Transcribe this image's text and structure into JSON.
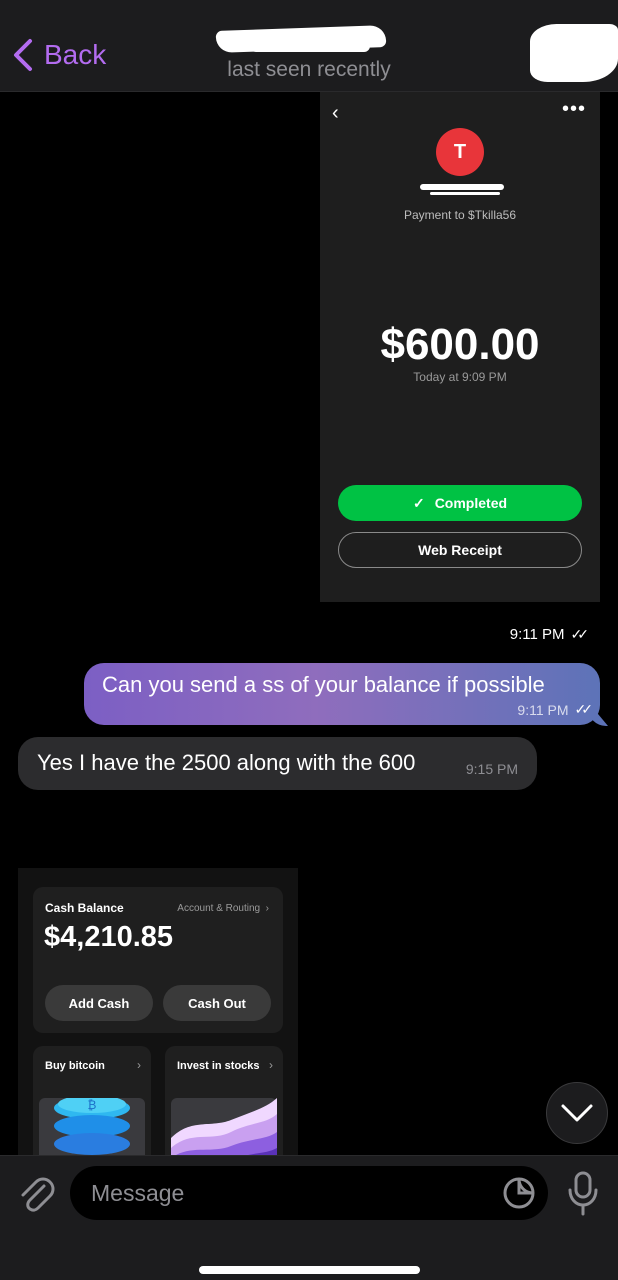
{
  "header": {
    "back_label": "Back",
    "subtitle": "last seen recently"
  },
  "receipt": {
    "avatar_letter": "T",
    "payment_to": "Payment to $Tkilla56",
    "amount": "$600.00",
    "date": "Today at 9:09 PM",
    "status_label": "Completed",
    "web_receipt_label": "Web Receipt",
    "more_label": "•••",
    "back_label": "‹",
    "status_color": "#00c244"
  },
  "receipt_time": "9:11 PM",
  "outgoing_message": {
    "text": "Can you send a ss of your balance if possible",
    "time": "9:11 PM"
  },
  "incoming_message": {
    "text": "Yes I have the 2500 along with the 600",
    "time": "9:15 PM"
  },
  "balance_shot": {
    "label": "Cash Balance",
    "routing_label": "Account & Routing",
    "amount": "$4,210.85",
    "add_cash_label": "Add Cash",
    "cash_out_label": "Cash Out",
    "tile_bitcoin_label": "Buy bitcoin",
    "tile_stocks_label": "Invest in stocks"
  },
  "composer": {
    "placeholder": "Message"
  },
  "colors": {
    "accent": "#b36cf0",
    "outgoing_bubble_start": "#7c5fc4",
    "outgoing_bubble_end": "#5d73b8",
    "incoming_bubble": "#2c2c2e",
    "avatar_red": "#e8353a"
  },
  "icons": {
    "back": "chevron-left-icon",
    "scroll_down": "chevron-down-icon",
    "attach": "paperclip-icon",
    "sticker": "sticker-icon",
    "mic": "microphone-icon",
    "read": "double-check-icon"
  }
}
